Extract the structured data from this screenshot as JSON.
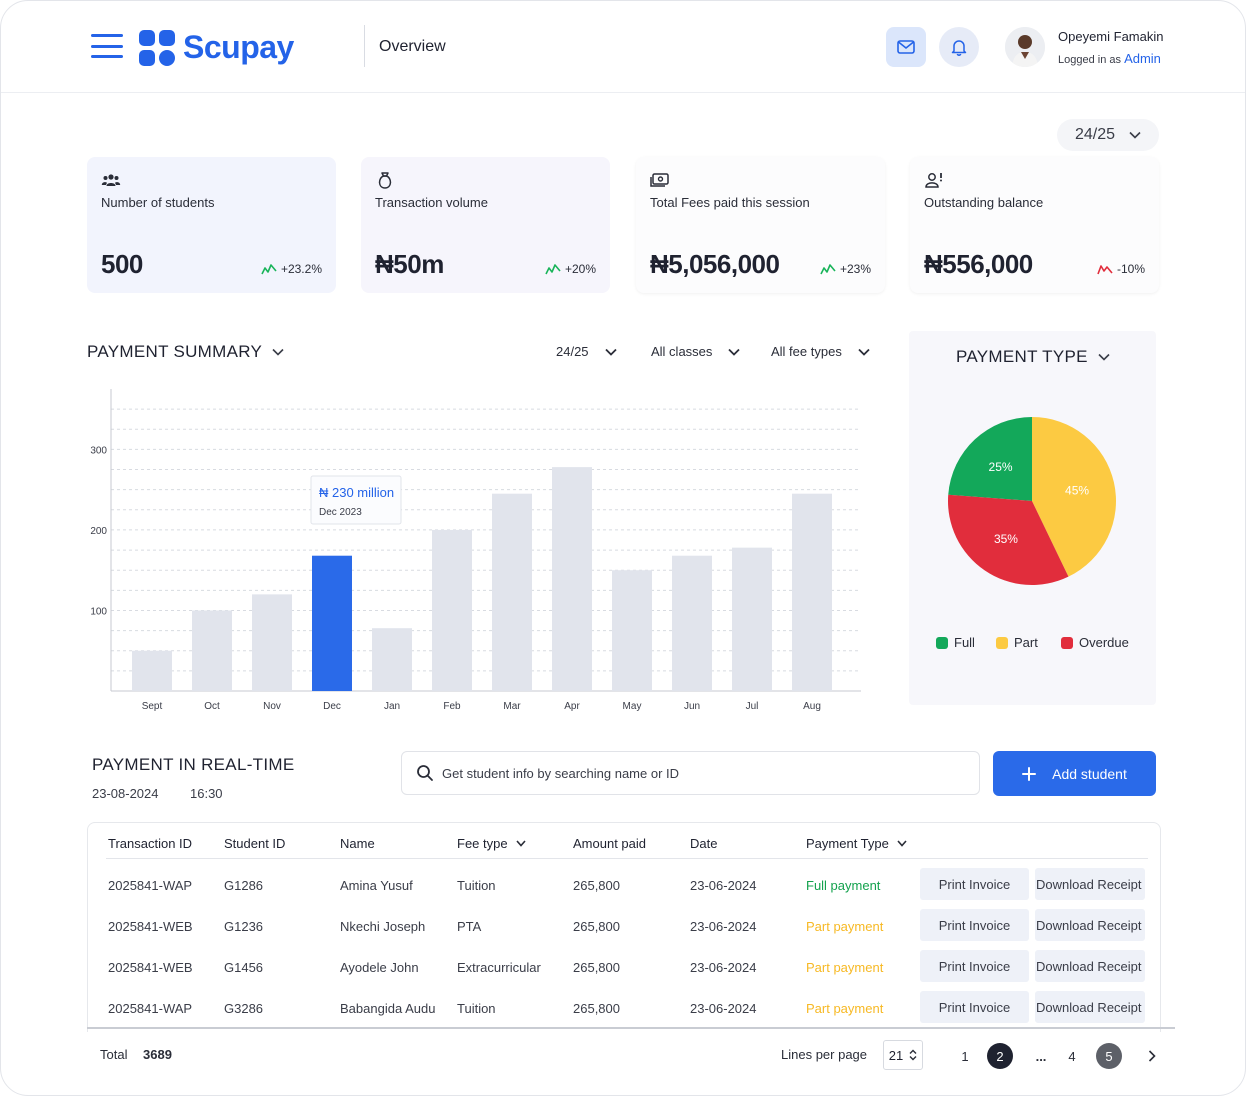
{
  "brand": {
    "name": "Scupay",
    "color": "#2463e8"
  },
  "header": {
    "title": "Overview",
    "user_name": "Opeyemi Famakin",
    "user_role_prefix": "Logged in as",
    "user_role": "Admin",
    "icons": [
      "mail-icon",
      "bell-icon"
    ]
  },
  "session_selector": "24/25",
  "stats": [
    {
      "icon": "students-icon",
      "label": "Number of students",
      "value": "500",
      "delta": "+23.2%",
      "trend": "up"
    },
    {
      "icon": "money-bag-icon",
      "label": "Transaction volume",
      "value": "₦50m",
      "delta": "+20%",
      "trend": "up"
    },
    {
      "icon": "cash-icon",
      "label": "Total Fees paid this session",
      "value": "₦5,056,000",
      "delta": "+23%",
      "trend": "up"
    },
    {
      "icon": "user-alert-icon",
      "label": "Outstanding balance",
      "value": "₦556,000",
      "delta": "-10%",
      "trend": "down"
    }
  ],
  "payment_summary": {
    "title": "PAYMENT SUMMARY",
    "filters": [
      "24/25",
      "All classes",
      "All fee types"
    ],
    "tooltip": {
      "value": "₦ 230 million",
      "date": "Dec 2023"
    }
  },
  "chart_data": [
    {
      "type": "bar",
      "title": "PAYMENT SUMMARY",
      "categories": [
        "Sept",
        "Oct",
        "Nov",
        "Dec",
        "Jan",
        "Feb",
        "Mar",
        "Apr",
        "May",
        "Jun",
        "Jul",
        "Aug"
      ],
      "values": [
        50,
        100,
        120,
        168,
        78,
        200,
        245,
        278,
        150,
        168,
        178,
        245
      ],
      "highlight_index": 3,
      "colors": {
        "bar": "#e1e4ec",
        "highlight": "#2a6ae9"
      },
      "yticks": [
        100,
        200,
        300
      ],
      "ylim": [
        0,
        375
      ],
      "grid": true
    },
    {
      "type": "pie",
      "title": "PAYMENT TYPE",
      "labels": [
        "Full",
        "Part",
        "Overdue"
      ],
      "values": [
        25,
        45,
        35
      ],
      "value_labels": [
        "25%",
        "45%",
        "35%"
      ],
      "colors": [
        "#13a85a",
        "#fcca42",
        "#e12d3c"
      ]
    }
  ],
  "realtime": {
    "title": "PAYMENT IN REAL-TIME",
    "date": "23-08-2024",
    "time": "16:30",
    "search_placeholder": "Get student info by searching name or ID",
    "add_label": "Add student"
  },
  "table": {
    "headers": [
      "Transaction ID",
      "Student ID",
      "Name",
      "Fee type",
      "Amount paid",
      "Date",
      "Payment Type"
    ],
    "print_label": "Print Invoice",
    "download_label": "Download Receipt",
    "status_colors": {
      "full": "#14a24e",
      "part": "#f7b924"
    },
    "rows": [
      {
        "txn": "2025841-WAP",
        "sid": "G1286",
        "name": "Amina Yusuf",
        "fee": "Tuition",
        "amount": "265,800",
        "date": "23-06-2024",
        "status": "Full payment",
        "kind": "full"
      },
      {
        "txn": "2025841-WEB",
        "sid": "G1236",
        "name": "Nkechi Joseph",
        "fee": "PTA",
        "amount": "265,800",
        "date": "23-06-2024",
        "status": "Part payment",
        "kind": "part"
      },
      {
        "txn": "2025841-WEB",
        "sid": "G1456",
        "name": "Ayodele John",
        "fee": "Extracurricular",
        "amount": "265,800",
        "date": "23-06-2024",
        "status": "Part payment",
        "kind": "part"
      },
      {
        "txn": "2025841-WAP",
        "sid": "G3286",
        "name": "Babangida Audu",
        "fee": "Tuition",
        "amount": "265,800",
        "date": "23-06-2024",
        "status": "Part payment",
        "kind": "part"
      }
    ]
  },
  "footer": {
    "total_label": "Total",
    "total_value": "3689",
    "lines_label": "Lines per page",
    "lines_value": "21",
    "pages": [
      "1",
      "2",
      "...",
      "4",
      "5"
    ]
  }
}
